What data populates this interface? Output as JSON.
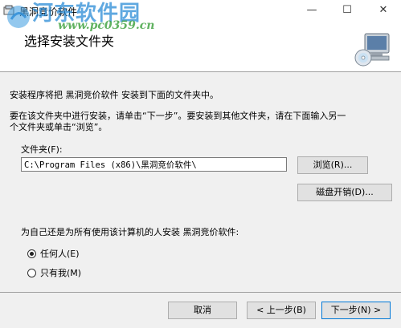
{
  "window": {
    "title": "黑洞竞价软件",
    "minimize": "—",
    "maximize": "☐",
    "close": "✕"
  },
  "watermark": {
    "name": "河东软件园",
    "url": "www.pc0359.cn"
  },
  "header": {
    "title": "选择安装文件夹"
  },
  "body": {
    "line1": "安装程序将把 黑洞竞价软件 安装到下面的文件夹中。",
    "line2a": "要在该文件夹中进行安装，请单击“下一步”。要安装到其他文件夹，请在下面输入另一",
    "line2b": "个文件夹或单击“浏览”。"
  },
  "folder": {
    "label": "文件夹(F):",
    "value": "C:\\Program Files (x86)\\黑洞竞价软件\\"
  },
  "buttons": {
    "browse": "浏览(R)...",
    "disk_cost": "磁盘开销(D)...",
    "cancel": "取消",
    "back": "< 上一步(B)",
    "next": "下一步(N) >"
  },
  "install_for": {
    "question": "为自己还是为所有使用该计算机的人安装 黑洞竞价软件:",
    "options": [
      {
        "label": "任何人(E)",
        "selected": true
      },
      {
        "label": "只有我(M)",
        "selected": false
      }
    ]
  }
}
